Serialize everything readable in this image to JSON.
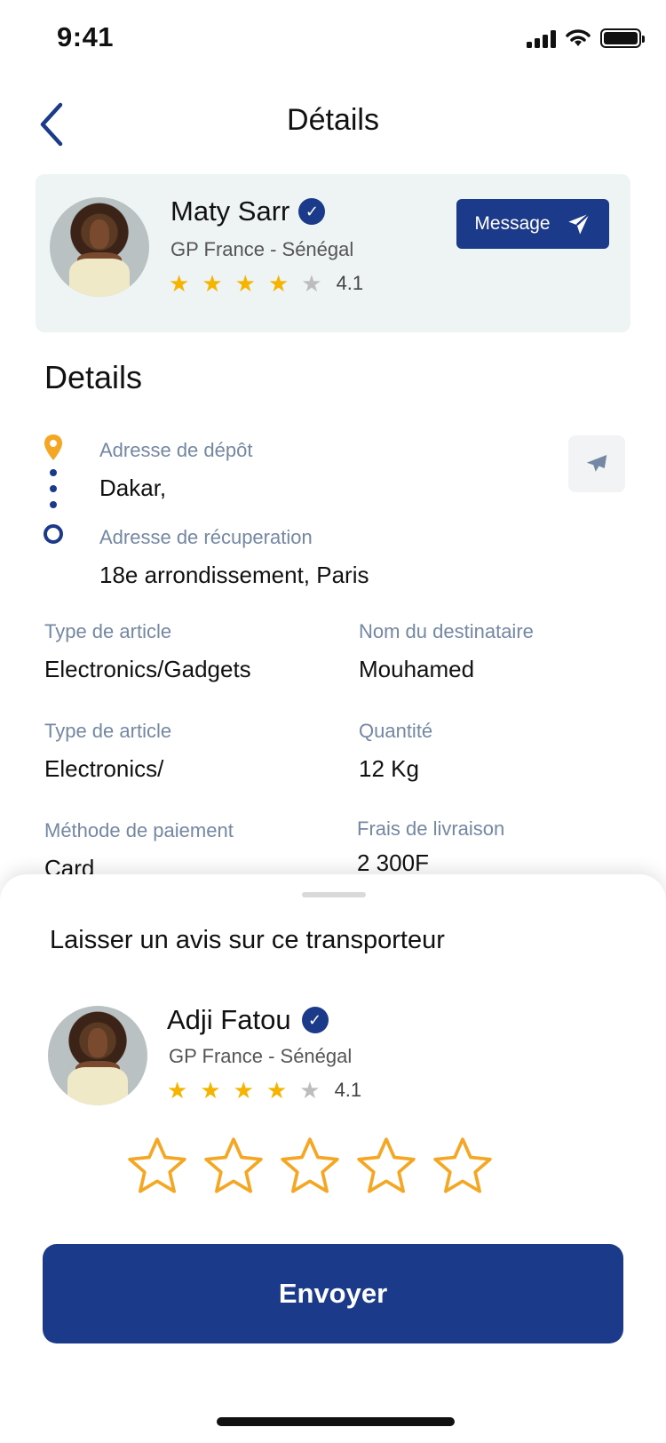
{
  "status": {
    "time": "9:41"
  },
  "header": {
    "title": "Détails"
  },
  "carrier_card": {
    "name": "Maty Sarr",
    "route": "GP France - Sénégal",
    "rating": "4.1",
    "stars_filled": 4,
    "message_label": "Message"
  },
  "details": {
    "title": "Details",
    "pickup_label": "Adresse de dépôt",
    "pickup_value": "Dakar,",
    "dropoff_label": "Adresse de récuperation",
    "dropoff_value": "18e arrondissement, Paris",
    "fields": [
      {
        "label": "Type de article",
        "value": "Electronics/Gadgets"
      },
      {
        "label": "Nom du destinataire",
        "value": "Mouhamed"
      },
      {
        "label": "Type de article",
        "value": "Electronics/"
      },
      {
        "label": "Quantité",
        "value": "12 Kg"
      },
      {
        "label": "Méthode de paiement",
        "value": "Card"
      },
      {
        "label": "Frais de livraison",
        "value": "2 300F"
      }
    ]
  },
  "review_sheet": {
    "title": "Laisser un avis sur ce transporteur",
    "name": "Adji Fatou",
    "route": "GP France - Sénégal",
    "rating": "4.1",
    "stars_filled": 4,
    "user_rating": 0,
    "submit_label": "Envoyer"
  },
  "colors": {
    "primary": "#1c3a8a",
    "star": "#f5b400",
    "accent_pin": "#f5a623",
    "muted": "#7487a3"
  }
}
